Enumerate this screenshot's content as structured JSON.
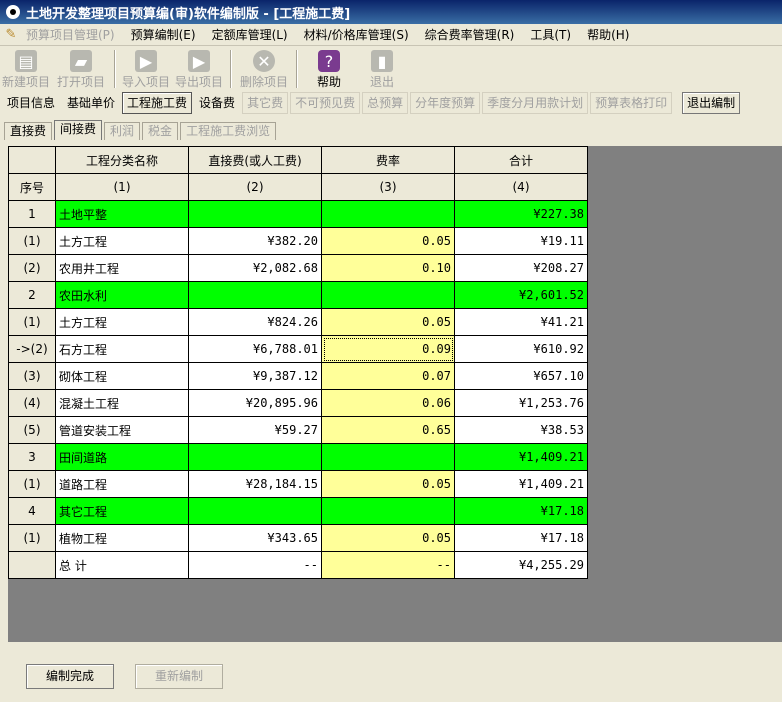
{
  "window": {
    "title": "土地开发整理项目预算编(审)软件编制版 - [工程施工费]"
  },
  "menu": [
    {
      "label": "预算项目管理(P)",
      "disabled": true
    },
    {
      "label": "预算编制(E)",
      "disabled": false
    },
    {
      "label": "定额库管理(L)",
      "disabled": false
    },
    {
      "label": "材料/价格库管理(S)",
      "disabled": false
    },
    {
      "label": "综合费率管理(R)",
      "disabled": false
    },
    {
      "label": "工具(T)",
      "disabled": false
    },
    {
      "label": "帮助(H)",
      "disabled": false
    }
  ],
  "toolbar": {
    "new_project": "新建项目",
    "open_project": "打开项目",
    "import_project": "导入项目",
    "export_project": "导出项目",
    "delete_project": "删除项目",
    "help": "帮助",
    "exit": "退出"
  },
  "nav": {
    "project_info": "项目信息",
    "base_price": "基础单价",
    "construction_cost": "工程施工费",
    "equipment_cost": "设备费",
    "other_cost": "其它费",
    "contingency": "不可预见费",
    "total_budget": "总预算",
    "annual_budget": "分年度预算",
    "quarterly_plan": "季度分月用款计划",
    "print_budget": "预算表格打印",
    "exit_edit": "退出编制"
  },
  "subtabs": {
    "direct": "直接费",
    "indirect": "间接费",
    "profit": "利润",
    "tax": "税金",
    "browse": "工程施工费浏览"
  },
  "table": {
    "headers": [
      "",
      "工程分类名称",
      "直接费(或人工费)",
      "费率",
      "合计"
    ],
    "subheaders": [
      "序号",
      "(1)",
      "(2)",
      "(3)",
      "(4)"
    ],
    "rows": [
      {
        "no": "1",
        "name": "土地平整",
        "direct": "",
        "rate": "",
        "total": "¥227.38",
        "category": true
      },
      {
        "no": "(1)",
        "name": "土方工程",
        "direct": "¥382.20",
        "rate": "0.05",
        "total": "¥19.11",
        "category": false
      },
      {
        "no": "(2)",
        "name": "农用井工程",
        "direct": "¥2,082.68",
        "rate": "0.10",
        "total": "¥208.27",
        "category": false
      },
      {
        "no": "2",
        "name": "农田水利",
        "direct": "",
        "rate": "",
        "total": "¥2,601.52",
        "category": true
      },
      {
        "no": "(1)",
        "name": "土方工程",
        "direct": "¥824.26",
        "rate": "0.05",
        "total": "¥41.21",
        "category": false
      },
      {
        "no": "->(2)",
        "name": "石方工程",
        "direct": "¥6,788.01",
        "rate": "0.09",
        "total": "¥610.92",
        "category": false,
        "selected": true
      },
      {
        "no": "(3)",
        "name": "砌体工程",
        "direct": "¥9,387.12",
        "rate": "0.07",
        "total": "¥657.10",
        "category": false
      },
      {
        "no": "(4)",
        "name": "混凝土工程",
        "direct": "¥20,895.96",
        "rate": "0.06",
        "total": "¥1,253.76",
        "category": false
      },
      {
        "no": "(5)",
        "name": "管道安装工程",
        "direct": "¥59.27",
        "rate": "0.65",
        "total": "¥38.53",
        "category": false
      },
      {
        "no": "3",
        "name": "田间道路",
        "direct": "",
        "rate": "",
        "total": "¥1,409.21",
        "category": true
      },
      {
        "no": "(1)",
        "name": "道路工程",
        "direct": "¥28,184.15",
        "rate": "0.05",
        "total": "¥1,409.21",
        "category": false
      },
      {
        "no": "4",
        "name": "其它工程",
        "direct": "",
        "rate": "",
        "total": "¥17.18",
        "category": true
      },
      {
        "no": "(1)",
        "name": "植物工程",
        "direct": "¥343.65",
        "rate": "0.05",
        "total": "¥17.18",
        "category": false
      },
      {
        "no": "",
        "name": "总    计",
        "direct": "--",
        "rate": "--",
        "total": "¥4,255.29",
        "category": false
      }
    ]
  },
  "buttons": {
    "finish": "编制完成",
    "re_edit": "重新编制"
  },
  "colors": {
    "category_row": "#00ff00",
    "rate_column": "#ffff99",
    "grid_background": "#808080"
  }
}
